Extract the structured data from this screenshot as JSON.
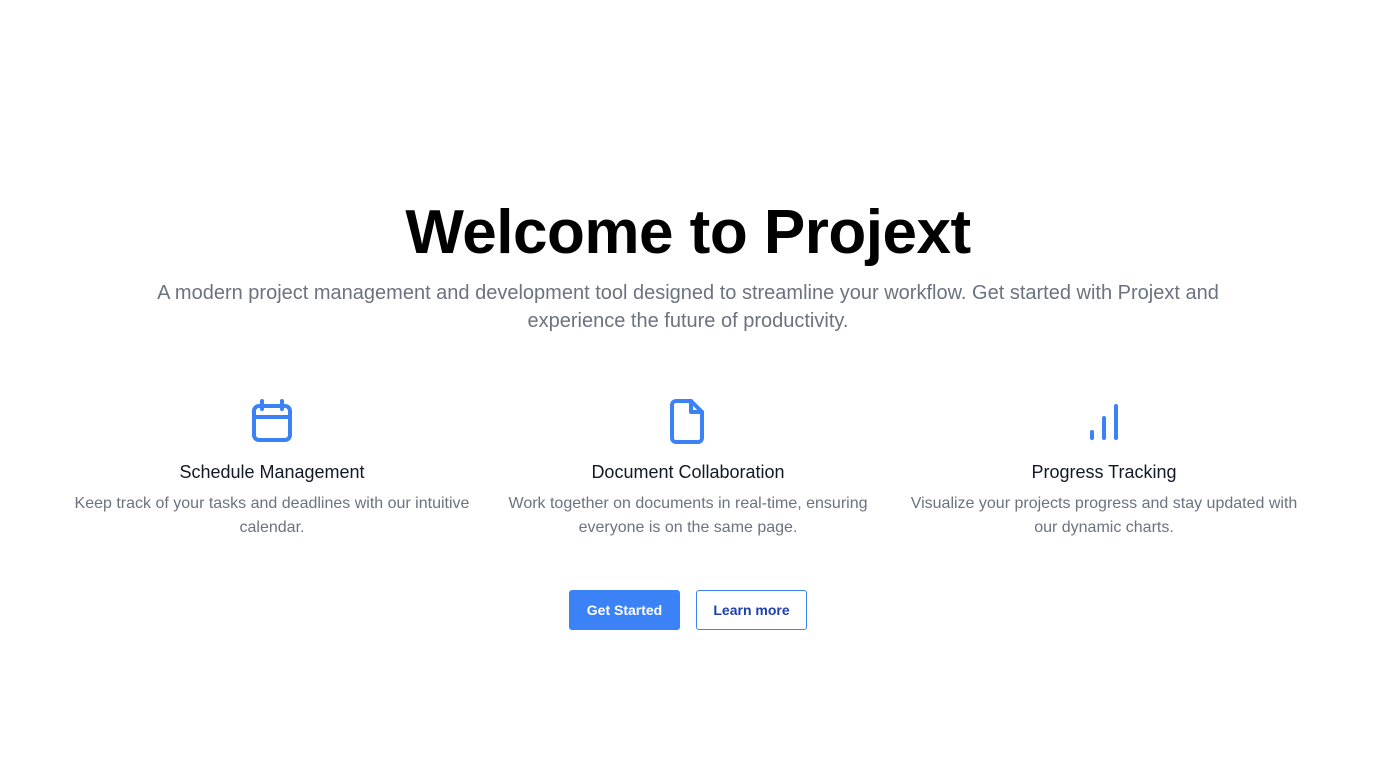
{
  "hero": {
    "title": "Welcome to Projext",
    "subtitle": "A modern project management and development tool designed to streamline your workflow. Get started with Projext and experience the future of productivity."
  },
  "features": [
    {
      "icon": "calendar-icon",
      "title": "Schedule Management",
      "description": "Keep track of your tasks and deadlines with our intuitive calendar."
    },
    {
      "icon": "document-icon",
      "title": "Document Collaboration",
      "description": "Work together on documents in real-time, ensuring everyone is on the same page."
    },
    {
      "icon": "bar-chart-icon",
      "title": "Progress Tracking",
      "description": "Visualize your projects progress and stay updated with our dynamic charts."
    }
  ],
  "actions": {
    "primary_label": "Get Started",
    "secondary_label": "Learn more"
  },
  "colors": {
    "accent": "#3b82f6",
    "title": "#000000",
    "muted": "#6b7280",
    "heading": "#111827"
  }
}
